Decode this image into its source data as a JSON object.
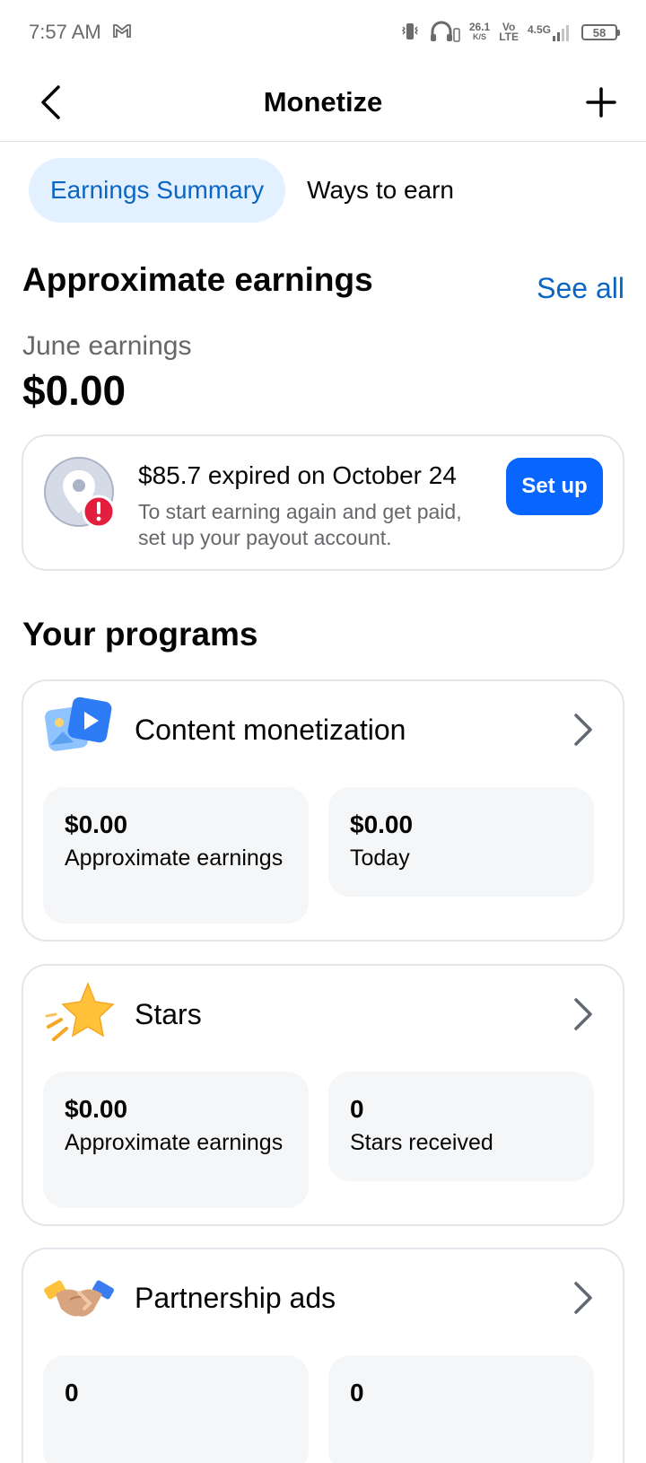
{
  "status_bar": {
    "time": "7:57 AM",
    "speed_value": "26.1",
    "speed_unit": "K/S",
    "volte_top": "Vo",
    "volte_bottom": "LTE",
    "network": "4.5G",
    "battery": "58"
  },
  "header": {
    "title": "Monetize"
  },
  "tabs": [
    {
      "label": "Earnings Summary",
      "active": true
    },
    {
      "label": "Ways to earn",
      "active": false
    }
  ],
  "earnings": {
    "title": "Approximate earnings",
    "see_all": "See all",
    "month_label": "June earnings",
    "amount": "$0.00"
  },
  "alert": {
    "title": "$85.7 expired on October 24",
    "description": "To start earning again and get paid, set up your payout account.",
    "button": "Set up"
  },
  "programs_title": "Your programs",
  "programs": [
    {
      "title": "Content monetization",
      "stats": [
        {
          "value": "$0.00",
          "label": "Approximate earnings"
        },
        {
          "value": "$0.00",
          "label": "Today"
        }
      ]
    },
    {
      "title": "Stars",
      "stats": [
        {
          "value": "$0.00",
          "label": "Approximate earnings"
        },
        {
          "value": "0",
          "label": "Stars received"
        }
      ]
    },
    {
      "title": "Partnership ads",
      "stats": [
        {
          "value": "0",
          "label": ""
        },
        {
          "value": "0",
          "label": ""
        }
      ]
    }
  ],
  "colors": {
    "accent": "#0a66c2",
    "button": "#0866ff",
    "tab_active_bg": "#e3f0ff",
    "alert_badge": "#e41e3f"
  }
}
